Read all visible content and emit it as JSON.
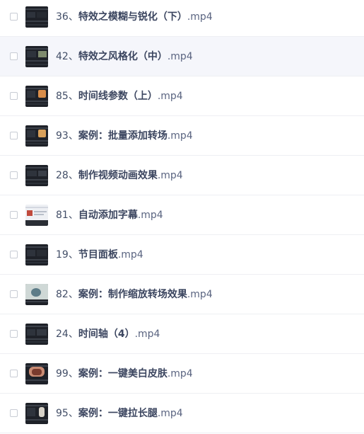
{
  "files": [
    {
      "number": "36、",
      "title": "特效之模糊与锐化（下）",
      "ext": ".mp4",
      "thumb": "dark-editor",
      "selected": false
    },
    {
      "number": "42、",
      "title": "特效之风格化（中）",
      "ext": ".mp4",
      "thumb": "dark-editor-image",
      "selected": true
    },
    {
      "number": "85、",
      "title": "时间线参数（上）",
      "ext": ".mp4",
      "thumb": "dark-editor-orange",
      "selected": false
    },
    {
      "number": "93、",
      "title": "案例：批量添加转场",
      "ext": ".mp4",
      "thumb": "dark-editor-orange",
      "selected": false
    },
    {
      "number": "28、",
      "title": "制作视频动画效果",
      "ext": ".mp4",
      "thumb": "dark-editor",
      "selected": false
    },
    {
      "number": "81、",
      "title": "自动添加字幕",
      "ext": ".mp4",
      "thumb": "light-editor",
      "selected": false
    },
    {
      "number": "19、",
      "title": "节目面板",
      "ext": ".mp4",
      "thumb": "dark-editor",
      "selected": false
    },
    {
      "number": "82、",
      "title": "案例：制作缩放转场效果",
      "ext": ".mp4",
      "thumb": "dark-editor-photo",
      "selected": false
    },
    {
      "number": "24、",
      "title": "时间轴（4）",
      "ext": ".mp4",
      "thumb": "dark-editor",
      "selected": false
    },
    {
      "number": "99、",
      "title": "案例：一键美白皮肤",
      "ext": ".mp4",
      "thumb": "dark-editor-face",
      "selected": false
    },
    {
      "number": "95、",
      "title": "案例：一键拉长腿",
      "ext": ".mp4",
      "thumb": "dark-editor-figure",
      "selected": false
    }
  ],
  "colors": {
    "text": "#424e67",
    "selected_row": "#f5f6fb",
    "divider": "#eeeff3",
    "thumb_bg": "#1e2128"
  }
}
